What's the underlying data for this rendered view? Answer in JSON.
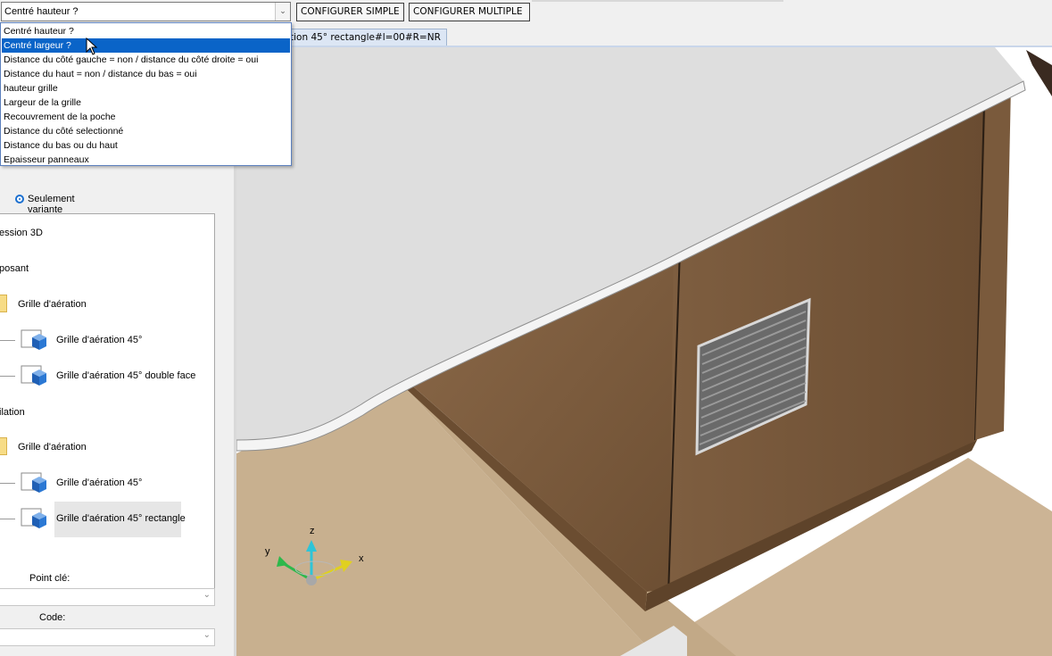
{
  "toolbar": {
    "combo_value": "Centré hauteur ?",
    "configure_simple_label": "CONFIGURER SIMPLE",
    "configure_multiple_label": "CONFIGURER MULTIPLE"
  },
  "dropdown": {
    "selected_index": 1,
    "options": [
      "Centré hauteur ?",
      "Centré largeur ?",
      "Distance du côté gauche = non / distance du côté droite = oui",
      "Distance du haut = non / distance du bas = oui",
      "hauteur grille",
      "Largeur de la grille",
      "Recouvrement de la poche",
      "Distance du côté selectionné",
      "Distance du bas ou du haut",
      "Epaisseur panneaux"
    ]
  },
  "tab": {
    "label": "tion 45° rectangle#l=00#R=NR"
  },
  "left_panel": {
    "radio_label": "Seulement variante",
    "tree": {
      "section1": "ession 3D",
      "section2": "posant",
      "group1_folder": "Grille d'aération",
      "group1_item1": "Grille d'aération 45°",
      "group1_item2": "Grille d'aération 45° double face",
      "section3": "ilation",
      "group2_folder": "Grille d'aération",
      "group2_item1": "Grille d'aération 45°",
      "group2_item2": "Grille d'aération 45° rectangle"
    },
    "key_point_label": "Point clé:",
    "code_label": "Code:"
  },
  "viewport": {
    "axis_x": "x",
    "axis_y": "y",
    "axis_z": "z"
  },
  "colors": {
    "selection": "#0a64c8",
    "wood": "#7d5d3f",
    "worktop": "#d9d9d9",
    "floor": "#cdb596"
  }
}
